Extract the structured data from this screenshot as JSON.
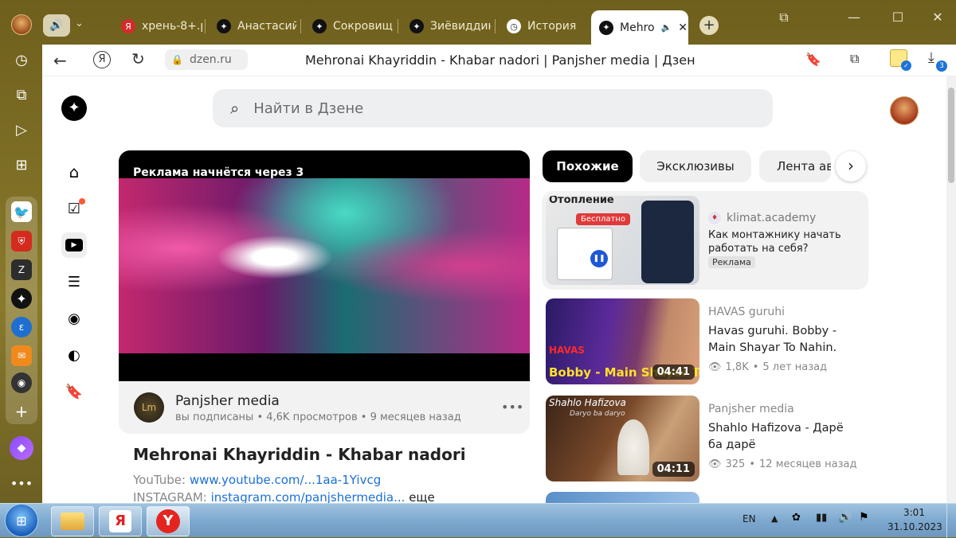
{
  "browser": {
    "tabs": [
      {
        "label": "хрень-8+.р",
        "icon": "yandex-red-icon"
      },
      {
        "label": "Анастасий",
        "icon": "dzen-icon"
      },
      {
        "label": "Сокровищ",
        "icon": "dzen-icon"
      },
      {
        "label": "Зиёвиддин",
        "icon": "dzen-icon"
      },
      {
        "label": "История",
        "icon": "clock-icon"
      },
      {
        "label": "Mehro",
        "icon": "dzen-icon"
      }
    ],
    "address": "dzen.ru",
    "page_title": "Mehronai Khayriddin - Khabar nadori | Panjsher media | Дзен",
    "downloads_badge": "3"
  },
  "dzen": {
    "search_placeholder": "Найти в Дзене",
    "ad_overlay": "Реклама начнётся через 3",
    "channel": "Panjsher media",
    "channel_meta": "вы подписаны • 4,6K просмотров • 9 месяцев назад",
    "video_title": "Mehronai Khayriddin - Khabar nadori",
    "desc_line1_label": "YouTube: ",
    "desc_line1_link": "www.youtube.com/...1aa-1Yivcg",
    "desc_line2_label": "INSTAGRAM: ",
    "desc_line2_link": "instagram.com/panjshermedia...",
    "desc_more": "еще",
    "chips": [
      "Похожие",
      "Эксклюзивы",
      "Лента ав"
    ],
    "ad_card": {
      "source": "klimat.academy",
      "title": "Как монтажнику начать работать на себя?",
      "badge": "Реклама",
      "thumb_top": "Отопление",
      "thumb_label": "Бесплатно"
    },
    "videos": [
      {
        "channel": "HAVAS guruhi",
        "title": "Havas guruhi. Bobby - Main Shayar To Nahin.",
        "views": "1,8K",
        "age": "5 лет назад",
        "duration": "04:41",
        "thumb_text": "Bobby - Main Shayar To",
        "thumb_top": "HAVAS"
      },
      {
        "channel": "Panjsher media",
        "title": "Shahlo Hafizova - Дарё ба дарё",
        "views": "325",
        "age": "12 месяцев назад",
        "duration": "04:11",
        "thumb_text": "Shahlo Hafizova",
        "thumb_sub": "Daryo ba daryo"
      }
    ]
  },
  "taskbar": {
    "lang": "EN",
    "time": "3:01",
    "date": "31.10.2023"
  }
}
